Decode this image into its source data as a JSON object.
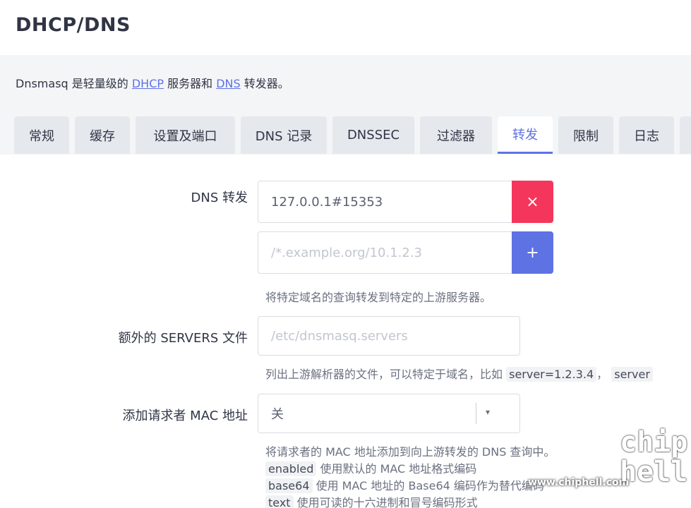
{
  "page": {
    "title": "DHCP/DNS"
  },
  "description": {
    "prefix": "Dnsmasq 是轻量级的 ",
    "link_dhcp": "DHCP",
    "middle": " 服务器和 ",
    "link_dns": "DNS",
    "suffix": " 转发器。"
  },
  "tabs": [
    {
      "label": "常规"
    },
    {
      "label": "缓存"
    },
    {
      "label": "设置及端口"
    },
    {
      "label": "DNS 记录"
    },
    {
      "label": "DNSSEC"
    },
    {
      "label": "过滤器"
    },
    {
      "label": "转发",
      "active": true
    },
    {
      "label": "限制"
    },
    {
      "label": "日志"
    }
  ],
  "dns_forward": {
    "label": "DNS 转发",
    "entries": [
      {
        "value": "127.0.0.1#15353"
      }
    ],
    "new_placeholder": "/*.example.org/10.1.2.3",
    "delete_symbol": "×",
    "add_symbol": "+",
    "help": "将特定域名的查询转发到特定的上游服务器。"
  },
  "servers_file": {
    "label": "额外的 SERVERS 文件",
    "placeholder": "/etc/dnsmasq.servers",
    "help_prefix": "列出上游解析器的文件，可以特定于域名，比如",
    "code1": "server=1.2.3.4",
    "sep": "，",
    "code2": "server"
  },
  "mac_address": {
    "label": "添加请求者 MAC 地址",
    "selected": "关",
    "caret": "▾",
    "help_line1": "将请求者的 MAC 地址添加到向上游转发的 DNS 查询中。",
    "options": [
      {
        "code": "enabled",
        "text": " 使用默认的 MAC 地址格式编码"
      },
      {
        "code": "base64",
        "text": " 使用 MAC 地址的 Base64 编码作为替代编码"
      },
      {
        "code": "text",
        "text": " 使用可读的十六进制和冒号编码形式"
      }
    ]
  },
  "watermark": {
    "site": "www.chiphell.com",
    "logo": "chip hell"
  },
  "colors": {
    "accent": "#5e72e4",
    "danger": "#f5365c",
    "text": "#303545"
  }
}
